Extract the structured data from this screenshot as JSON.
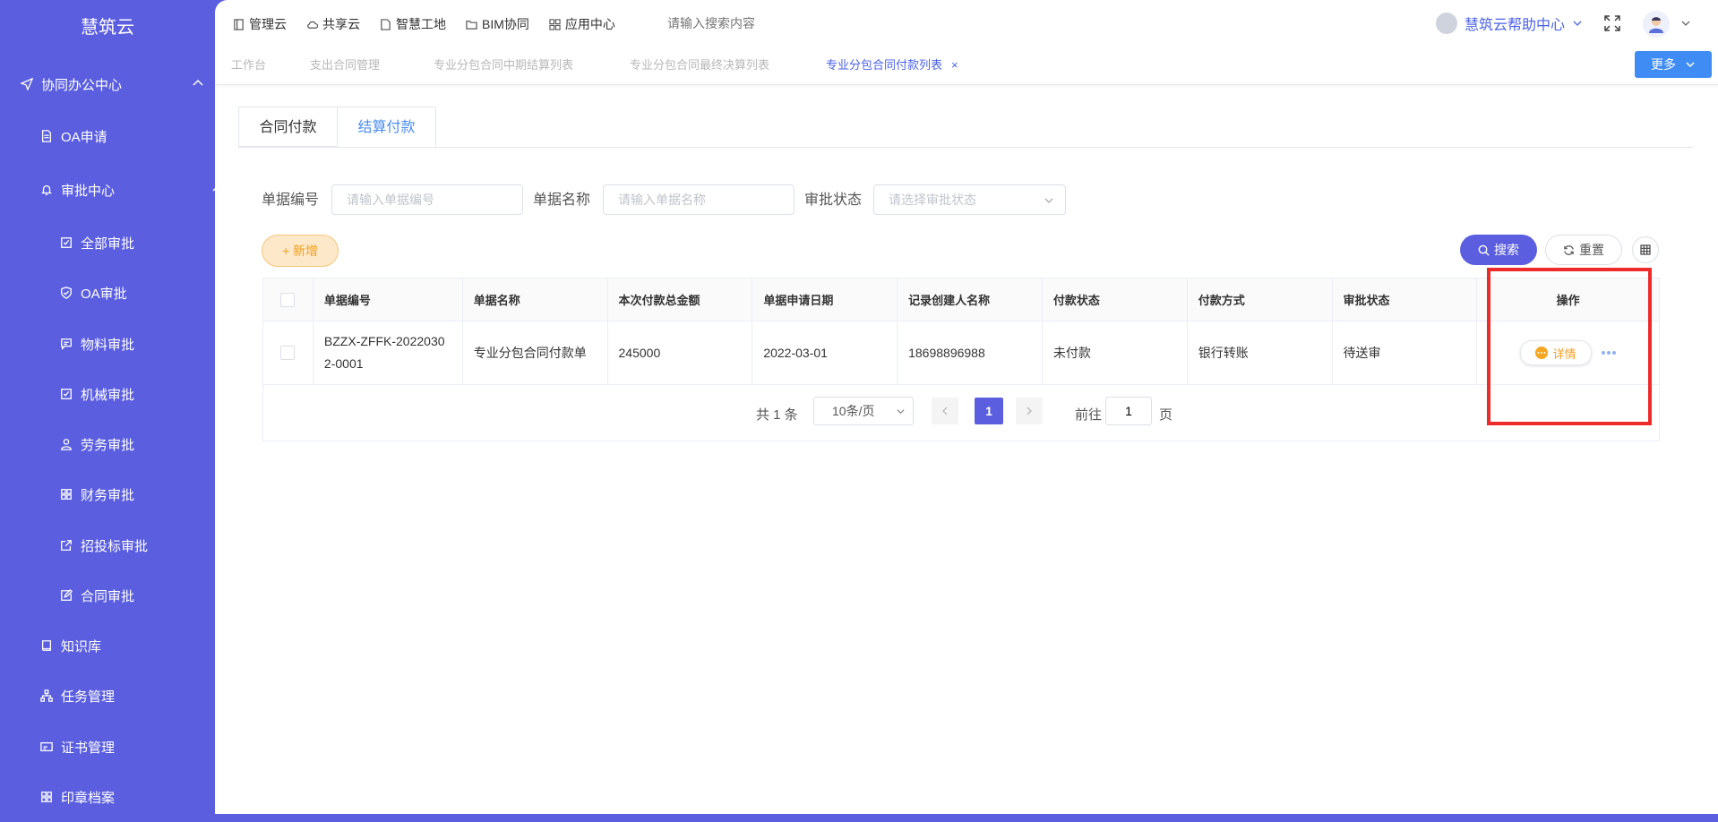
{
  "sidebar": {
    "brand": "慧筑云",
    "items": [
      {
        "label": "协同办公中心",
        "icon": "send-icon",
        "expanded": true
      },
      {
        "label": "OA申请",
        "icon": "document-icon"
      },
      {
        "label": "审批中心",
        "icon": "bell-icon",
        "expanded": true
      },
      {
        "label": "全部审批",
        "icon": "checkbox-icon"
      },
      {
        "label": "OA审批",
        "icon": "shield-check-icon"
      },
      {
        "label": "物料审批",
        "icon": "message-icon"
      },
      {
        "label": "机械审批",
        "icon": "checkbox-icon"
      },
      {
        "label": "劳务审批",
        "icon": "user-icon"
      },
      {
        "label": "财务审批",
        "icon": "grid-icon"
      },
      {
        "label": "招投标审批",
        "icon": "external-icon"
      },
      {
        "label": "合同审批",
        "icon": "edit-icon"
      },
      {
        "label": "知识库",
        "icon": "book-icon"
      },
      {
        "label": "任务管理",
        "icon": "org-icon"
      },
      {
        "label": "证书管理",
        "icon": "card-icon"
      },
      {
        "label": "印章档案",
        "icon": "grid-icon"
      }
    ]
  },
  "topnav": {
    "items": [
      "管理云",
      "共享云",
      "智慧工地",
      "BIM协同",
      "应用中心"
    ],
    "search_placeholder": "请输入搜索内容",
    "help_label": "慧筑云帮助中心"
  },
  "page_tabs": {
    "items": [
      "工作台",
      "支出合同管理",
      "专业分包合同中期结算列表",
      "专业分包合同最终决算列表",
      "专业分包合同付款列表"
    ],
    "active_index": 4,
    "close_symbol": "×",
    "more_label": "更多"
  },
  "content_tabs": {
    "items": [
      "合同付款",
      "结算付款"
    ],
    "active_index": 1
  },
  "filters": {
    "doc_no_label": "单据编号",
    "doc_no_placeholder": "请输入单据编号",
    "doc_name_label": "单据名称",
    "doc_name_placeholder": "请输入单据名称",
    "status_label": "审批状态",
    "status_placeholder": "请选择审批状态"
  },
  "actions": {
    "add_label": "+ 新增",
    "search_label": "搜索",
    "reset_label": "重置"
  },
  "table": {
    "columns": [
      "单据编号",
      "单据名称",
      "本次付款总金额",
      "单据申请日期",
      "记录创建人名称",
      "付款状态",
      "付款方式",
      "审批状态",
      "操作"
    ],
    "rows": [
      {
        "doc_no": "BZZX-ZFFK-20220302-0001",
        "doc_name": "专业分包合同付款单",
        "amount": "245000",
        "apply_date": "2022-03-01",
        "creator": "18698896988",
        "pay_status": "未付款",
        "pay_method": "银行转账",
        "approval_status": "待送审",
        "detail_label": "详情"
      }
    ]
  },
  "pagination": {
    "total_text": "共 1 条",
    "page_size": "10条/页",
    "current_page": "1",
    "goto_label": "前往",
    "goto_value": "1",
    "page_suffix": "页"
  },
  "colors": {
    "sidebar_bg": "#5b5fdf",
    "accent": "#5b5fdf",
    "link_blue": "#4b62e8",
    "add_orange": "#f0a020",
    "highlight_red": "#ee2b2b"
  }
}
